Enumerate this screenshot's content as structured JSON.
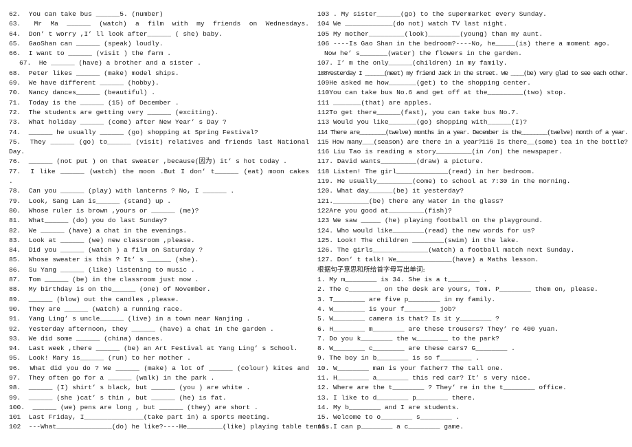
{
  "worksheet": {
    "left_column": [
      {
        "num": "62.",
        "text": "You can take bus ______5. (number)",
        "justify": false
      },
      {
        "num": "63.",
        "text": "Mr Ma ______ (watch) a film with my friends on Wednesdays.",
        "justify": true
      },
      {
        "num": "64.",
        "text": "Don’ t worry ,I’ ll look after______ ( she) baby.",
        "justify": false
      },
      {
        "num": "65.",
        "text": "GaoShan can ______ (speak) loudly.",
        "justify": false
      },
      {
        "num": "66.",
        "text": "I want to ______ (visit ) the farm .",
        "justify": false
      },
      {
        "num": "67.",
        "text": "He ______ (have) a brother and a sister .",
        "justify": false,
        "indent": true
      },
      {
        "num": "68.",
        "text": "Peter likes ______ (make) model ships.",
        "justify": false
      },
      {
        "num": "69.",
        "text": "We have different ______ (hobby).",
        "justify": false
      },
      {
        "num": "70.",
        "text": "Nancy dances______ (beautiful) .",
        "justify": false
      },
      {
        "num": "71.",
        "text": "Today is the ______ (15) of December .",
        "justify": false
      },
      {
        "num": "72.",
        "text": "The students are getting very ______ (exciting).",
        "justify": false
      },
      {
        "num": "73.",
        "text": "What holiday ______ (come) after New Year’ s Day ?",
        "justify": false
      },
      {
        "num": "74.",
        "text": "______ he usually ______ (go) shopping at Spring Festival?",
        "justify": false
      },
      {
        "num": "75.",
        "text": "They ______ (go) to______ (visit) relatives and friends last National",
        "justify": true
      },
      {
        "num": "",
        "text": "Day.",
        "justify": false
      },
      {
        "num": "76.",
        "text": "______ (not put ) on that sweater ,because(因为) it’ s hot today .",
        "justify": false
      },
      {
        "num": "77.",
        "text": "I like ______ (watch) the moon .But I don’ t______ (eat) moon cakes",
        "justify": true
      },
      {
        "num": "",
        "text": ".",
        "justify": false
      },
      {
        "num": "78.",
        "text": "Can you ______ (play) with lanterns ? No, I ______ .",
        "justify": false
      },
      {
        "num": "79.",
        "text": "Look, Sang Lan is______ (stand) up .",
        "justify": false
      },
      {
        "num": "80.",
        "text": "Whose ruler is brown ,yours or ______ (me)?",
        "justify": false
      },
      {
        "num": "81.",
        "text": "What______ (do) you do last Sunday?",
        "justify": false
      },
      {
        "num": "82.",
        "text": "We ______ (have) a chat in the evenings.",
        "justify": false
      },
      {
        "num": "83.",
        "text": "Look at ______ (we) new classroom ,please.",
        "justify": false
      },
      {
        "num": "84.",
        "text": "Did you ______ (watch ) a film on Saturday ?",
        "justify": false
      },
      {
        "num": "85.",
        "text": "Whose sweater is this ? It’ s ______ (she).",
        "justify": false
      },
      {
        "num": "86.",
        "text": "Su Yang ______ (like) listening to music .",
        "justify": false
      },
      {
        "num": "87.",
        "text": "Tom ______ (be) in the classroom just now .",
        "justify": false
      },
      {
        "num": "88.",
        "text": "My birthday is on the______ (one) of November.",
        "justify": false
      },
      {
        "num": "89.",
        "text": "______ (blow) out the candles ,please.",
        "justify": false
      },
      {
        "num": "90.",
        "text": "They are ______ (watch) a running race.",
        "justify": false
      },
      {
        "num": "91.",
        "text": "Yang Ling’ s uncle______ (live) in a town near Nanjing .",
        "justify": false
      },
      {
        "num": "92.",
        "text": "Yesterday afternoon, they ______ (have) a chat in the garden .",
        "justify": false
      },
      {
        "num": "93.",
        "text": "We did some ______ (china) dances.",
        "justify": false
      },
      {
        "num": "94.",
        "text": "Last week ,there ______ (be) an Art Festival at Yang Ling’ s School.",
        "justify": false
      },
      {
        "num": "95.",
        "text": "Look! Mary is______ (run) to her mother .",
        "justify": false
      },
      {
        "num": "96.",
        "text": "What did you do ? We ______ (make) a lot of ______ (colour) kites and flew ______ (they).",
        "justify": true
      },
      {
        "num": "97.",
        "text": "They often go for a ______ (walk) in the park .",
        "justify": false
      },
      {
        "num": "98.",
        "text": "______ (I) shirt’ s black, but ______ (you ) are white .",
        "justify": false
      },
      {
        "num": "99.",
        "text": "______ (she )cat’ s thin , but ______ (he) is fat.",
        "justify": false
      },
      {
        "num": "100.",
        "text": "______ (we) pens are long , but ______ (they) are short .",
        "justify": false
      },
      {
        "num": "101",
        "text": "Last Friday, I_______________(take part in) a sports meeting.",
        "justify": false
      },
      {
        "num": "102",
        "text": "---What______________(do) he like?----He_________(like) playing table tennis.",
        "justify": false
      }
    ],
    "right_column": [
      {
        "text": "103 . My sister______(go) to the supermarket every Sunday."
      },
      {
        "text": "104 We ____________(do not) watch TV last night."
      },
      {
        "text": "105 My mother_________(look)________(young) than my aunt."
      },
      {
        "text": "106 ----Is Gao Shan in the bedroom?----No, he_____(is) there a moment ago."
      },
      {
        "text": "Now he’ s_______(water) the flowers in the garden.",
        "indent": true
      },
      {
        "text": "107. I’ m the only______(children) in my family."
      },
      {
        "text": "108Yesterday I ______(meet) my friend Jack in the street. We ____(be) very glad to see each other."
      },
      {
        "text": "109He asked me how_______(get) to the shopping center."
      },
      {
        "text": "110You can take bus No.6 and get off at the_________(two) stop."
      },
      {
        "text": "111 _______(that) are apples."
      },
      {
        "text": "112To get there______(fast), you can take bus No.7."
      },
      {
        "text": "113 Would you like_______(go) shopping with______(I)?"
      },
      {
        "text": "114 There are________(twelve) months in a year. December is the________(twelve) month of a year."
      },
      {
        "text": "115 How many___(season) are there in a year?116 Is there__(some) tea in the bottle?"
      },
      {
        "text": "116 Liu Tao is reading a story_________(in /on) the newspaper."
      },
      {
        "text": "117. David wants_________(draw) a picture."
      },
      {
        "text": "118 Listen! The girl_____________(read) in her bedroom."
      },
      {
        "text": "119. He usually_________(come) to school at 7:30 in the morning."
      },
      {
        "text": "120. What day______(be) it yesterday?"
      },
      {
        "text": "121._________(be) there any water in the glass?"
      },
      {
        "text": "122Are you good at_________(fish)?"
      },
      {
        "text": "123 We saw _____ (he) playing football on the playground."
      },
      {
        "text": "124. Who would like________(read) the new words for us?"
      },
      {
        "text": "125. Look! The children ________(swim) in the lake."
      },
      {
        "text": "126. The girls______________(watch) a football match next Sunday."
      },
      {
        "text": "127. Don’ t talk! We______________(have) a Maths lesson."
      },
      {
        "text": "根据句子意思和所给首字母写出单词:",
        "heading": true
      },
      {
        "text": "1. My m________ is 34. She is a t________ ."
      },
      {
        "text": "2. The c________ on the desk are yours, Tom. P________ them on, please."
      },
      {
        "text": "3. T________ are five p________ in my family."
      },
      {
        "text": "4. W________ is your f________ job?"
      },
      {
        "text": "5. W________ camera is that? Is it y________ ?"
      },
      {
        "text": "6. H________ m________ are these trousers? They’ re 400 yuan."
      },
      {
        "text": "7. Do you k________ the w________ to the park?"
      },
      {
        "text": "8. W________ c________ are these cars? G________ ."
      },
      {
        "text": "9. The boy in b________ is so f________ ."
      },
      {
        "text": "10. W________ man is your father? The tall one."
      },
      {
        "text": "11. H________ a________ this red car? It’ s very nice."
      },
      {
        "text": "12. Where are the t________ ? They’ re in the t________ office."
      },
      {
        "text": "13. I like to d________ p________ there."
      },
      {
        "text": "14. My b________ and I are students."
      },
      {
        "text": "15. Welcome to o________ s________ ."
      },
      {
        "text": "16. I can p________ a c________ game."
      }
    ]
  }
}
